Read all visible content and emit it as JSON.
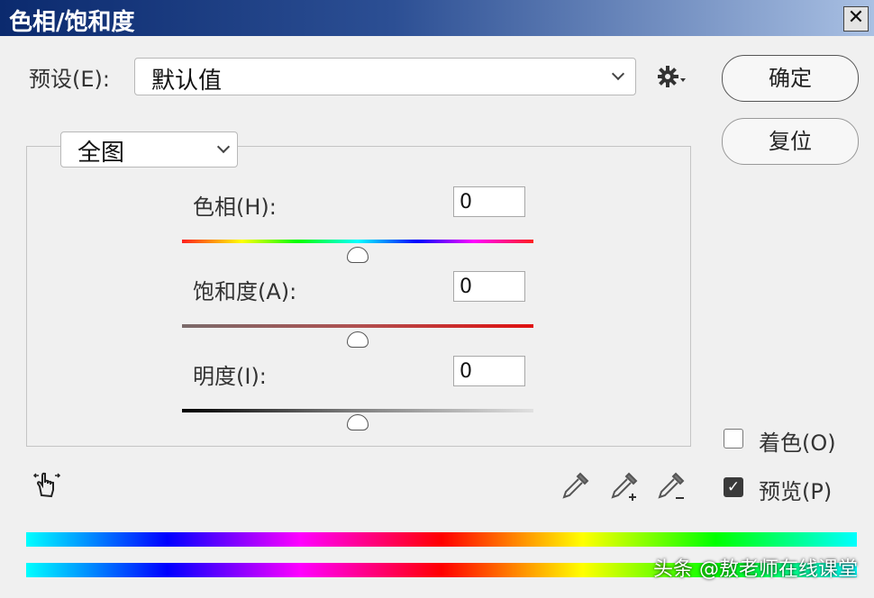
{
  "window": {
    "title": "色相/饱和度",
    "close_label": "✕"
  },
  "preset": {
    "label": "预设(E):",
    "value": "默认值"
  },
  "buttons": {
    "ok": "确定",
    "reset": "复位"
  },
  "channel": {
    "value": "全图"
  },
  "sliders": {
    "hue": {
      "label": "色相(H):",
      "value": "0",
      "level": 0
    },
    "saturation": {
      "label": "饱和度(A):",
      "value": "0",
      "level": 0
    },
    "lightness": {
      "label": "明度(I):",
      "value": "0",
      "level": 0
    }
  },
  "options": {
    "colorize": {
      "label": "着色(O)",
      "checked": false
    },
    "preview": {
      "label": "预览(P)",
      "checked": true
    }
  },
  "icons": [
    "gear-icon",
    "hand-adjust-icon",
    "eyedropper-icon",
    "eyedropper-plus-icon",
    "eyedropper-minus-icon"
  ],
  "colors": {
    "title_start": "#0b2a6e",
    "title_end": "#a9c0e3"
  },
  "watermark": "头条 @敖老师在线课堂"
}
